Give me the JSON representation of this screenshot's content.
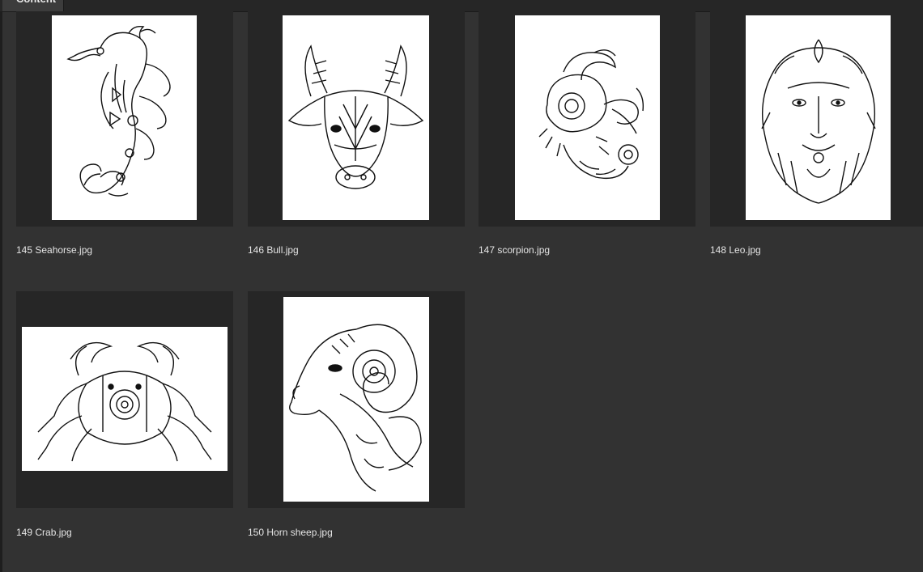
{
  "panel": {
    "tab_label": "Content"
  },
  "files": [
    {
      "name": "145 Seahorse.jpg",
      "subject": "seahorse-icon"
    },
    {
      "name": "146 Bull.jpg",
      "subject": "bull-icon"
    },
    {
      "name": "147 scorpion.jpg",
      "subject": "scorpion-icon"
    },
    {
      "name": "148 Leo.jpg",
      "subject": "lion-icon"
    },
    {
      "name": "149 Crab.jpg",
      "subject": "crab-icon"
    },
    {
      "name": "150 Horn sheep.jpg",
      "subject": "ram-icon"
    }
  ],
  "colors": {
    "background": "#323232",
    "thumb_frame": "#262626",
    "sheet": "#ffffff",
    "caption": "#e4e4e4"
  }
}
